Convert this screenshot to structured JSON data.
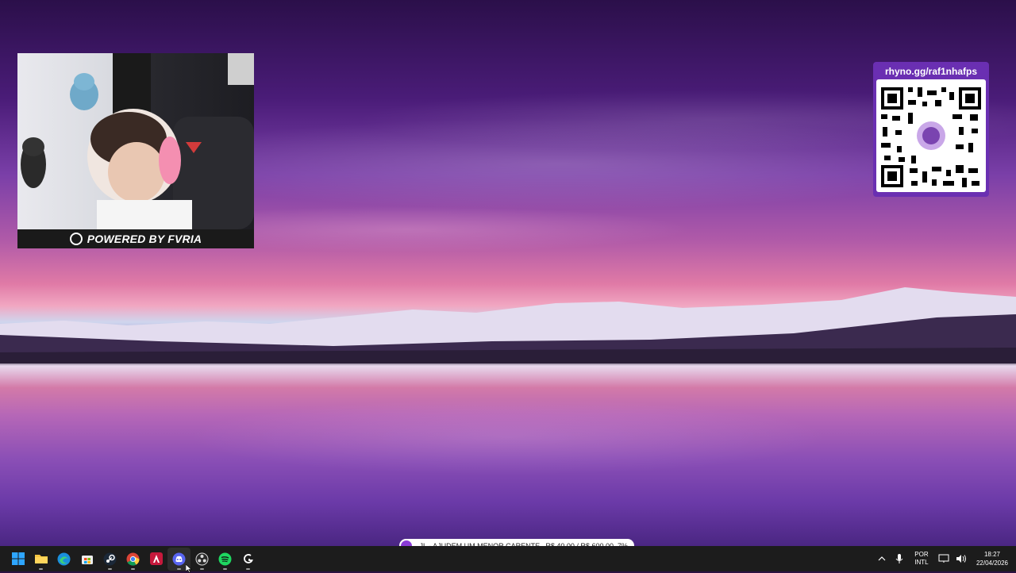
{
  "webcam": {
    "overlay_text": "POWERED BY FVRIA"
  },
  "qr": {
    "url_text": "rhyno.gg/raf1nhafps"
  },
  "ticker": {
    "message": "...JL - AJUDEM UM MENOR CARENTE.",
    "goal": "R$ 40,00 / R$ 600,00",
    "percent": "7%"
  },
  "taskbar": {
    "apps": [
      {
        "name": "start",
        "icon": "windows-logo-icon"
      },
      {
        "name": "file-explorer",
        "icon": "folder-icon"
      },
      {
        "name": "edge",
        "icon": "edge-icon"
      },
      {
        "name": "store",
        "icon": "store-icon"
      },
      {
        "name": "steam",
        "icon": "steam-icon"
      },
      {
        "name": "chrome",
        "icon": "chrome-icon"
      },
      {
        "name": "riot",
        "icon": "riot-icon"
      },
      {
        "name": "discord",
        "icon": "discord-icon",
        "active": true
      },
      {
        "name": "obs",
        "icon": "obs-icon"
      },
      {
        "name": "spotify",
        "icon": "spotify-icon"
      },
      {
        "name": "logitech",
        "icon": "logitech-icon"
      }
    ],
    "tray": {
      "lang_top": "POR",
      "lang_bottom": "INTL",
      "time": "18:27",
      "date": "22/04/2026"
    }
  },
  "colors": {
    "taskbar_bg": "#1c1c1c",
    "qr_accent": "#6a2fb2",
    "ticker_accent": "#8a3bd6"
  }
}
